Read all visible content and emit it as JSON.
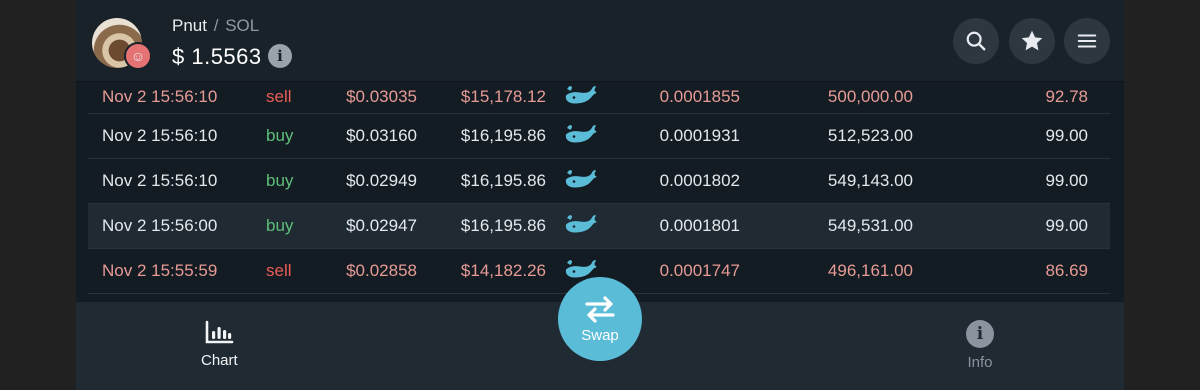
{
  "header": {
    "pair_base": "Pnut",
    "pair_sep": "/",
    "pair_quote": "SOL",
    "price": "$ 1.5563",
    "info_glyph": "i"
  },
  "table": {
    "rows": [
      {
        "time": "Nov 2 15:56:10",
        "side": "sell",
        "price": "$0.03035",
        "total": "$15,178.12",
        "sol_price": "0.0001855",
        "amount": "500,000.00",
        "value": "92.78"
      },
      {
        "time": "Nov 2 15:56:10",
        "side": "buy",
        "price": "$0.03160",
        "total": "$16,195.86",
        "sol_price": "0.0001931",
        "amount": "512,523.00",
        "value": "99.00"
      },
      {
        "time": "Nov 2 15:56:10",
        "side": "buy",
        "price": "$0.02949",
        "total": "$16,195.86",
        "sol_price": "0.0001802",
        "amount": "549,143.00",
        "value": "99.00"
      },
      {
        "time": "Nov 2 15:56:00",
        "side": "buy",
        "price": "$0.02947",
        "total": "$16,195.86",
        "sol_price": "0.0001801",
        "amount": "549,531.00",
        "value": "99.00"
      },
      {
        "time": "Nov 2 15:55:59",
        "side": "sell",
        "price": "$0.02858",
        "total": "$14,182.26",
        "sol_price": "0.0001747",
        "amount": "496,161.00",
        "value": "86.69"
      }
    ]
  },
  "nav": {
    "chart_label": "Chart",
    "swap_label": "Swap",
    "info_label": "Info",
    "info_glyph": "i"
  },
  "colors": {
    "buy": "#5fbf7b",
    "sell": "#ea5d57",
    "accent": "#5bbcd8"
  },
  "icons": [
    "search-icon",
    "star-icon",
    "menu-icon",
    "whale-icon",
    "chart-icon",
    "swap-icon",
    "info-icon"
  ]
}
